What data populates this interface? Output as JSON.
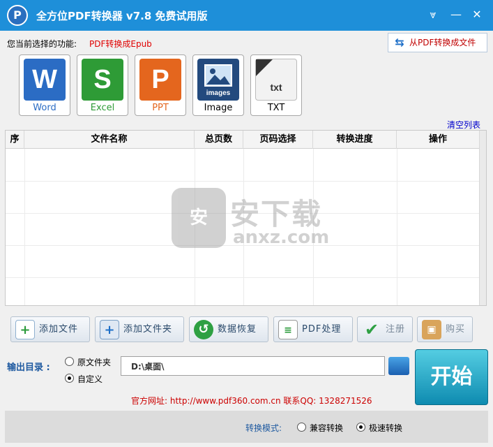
{
  "window": {
    "title": "全方位PDF转换器 v7.8 免费试用版",
    "logo_letter": "P",
    "menu_glyph": "⩔",
    "minimize_glyph": "—",
    "close_glyph": "✕"
  },
  "function_bar": {
    "label": "您当前选择的功能:",
    "current": "PDF转换成Epub",
    "switch_button": "从PDF转换成文件"
  },
  "formats": [
    {
      "label": "Word",
      "glyph": "W",
      "color": "#2b6cc4"
    },
    {
      "label": "Excel",
      "glyph": "S",
      "color": "#2e9b36"
    },
    {
      "label": "PPT",
      "glyph": "P",
      "color": "#e4661e"
    },
    {
      "label": "Image",
      "glyph": "images",
      "color": "#234a7e"
    },
    {
      "label": "TXT",
      "glyph": "txt",
      "color": "#f2f2f2"
    }
  ],
  "clear_list": "清空列表",
  "table": {
    "columns": [
      "序",
      "文件名称",
      "总页数",
      "页码选择",
      "转换进度",
      "操作"
    ],
    "rows": []
  },
  "watermark": {
    "shield_char": "安",
    "cn": "安下载",
    "en": "anxz.com"
  },
  "toolbar": [
    {
      "label": "添加文件",
      "icon": "add-file-icon"
    },
    {
      "label": "添加文件夹",
      "icon": "add-folder-icon"
    },
    {
      "label": "数据恢复",
      "icon": "restore-icon"
    },
    {
      "label": "PDF处理",
      "icon": "pdf-process-icon"
    },
    {
      "label": "注册",
      "icon": "checkmark-icon"
    },
    {
      "label": "购买",
      "icon": "shopping-bag-icon"
    }
  ],
  "output": {
    "label": "输出目录 :",
    "option_original": "原文件夹",
    "option_custom": "自定义",
    "selected": "自定义",
    "path": "D:\\桌面\\"
  },
  "start_button": "开始",
  "site_info": "官方网址: http://www.pdf360.com.cn     联系QQ: 1328271526",
  "mode": {
    "label": "转换模式:",
    "option_compat": "兼容转换",
    "option_fast": "极速转换",
    "selected": "极速转换"
  }
}
